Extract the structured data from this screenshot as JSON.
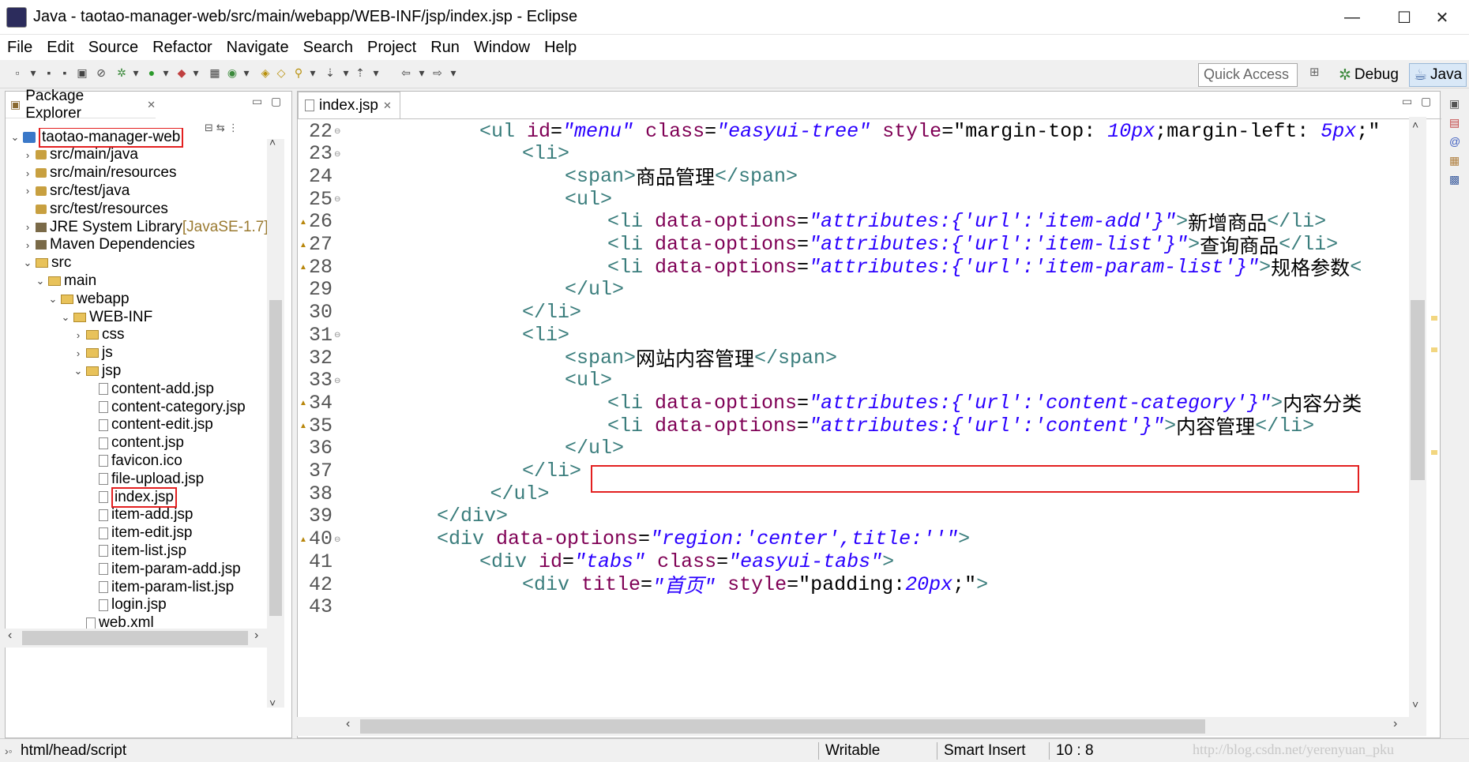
{
  "window": {
    "title": "Java - taotao-manager-web/src/main/webapp/WEB-INF/jsp/index.jsp - Eclipse",
    "minimize": "—",
    "maximize": "☐",
    "close": "✕"
  },
  "menu": [
    "File",
    "Edit",
    "Source",
    "Refactor",
    "Navigate",
    "Search",
    "Project",
    "Run",
    "Window",
    "Help"
  ],
  "toolbar": {
    "quick_access": "Quick Access",
    "perspectives": [
      "Debug",
      "Java"
    ]
  },
  "package_explorer": {
    "title": "Package Explorer",
    "items": [
      {
        "label": "taotao-manager-web",
        "depth": 0,
        "twisty": "⌄",
        "icon": "project-icon"
      },
      {
        "label": "src/main/java",
        "depth": 1,
        "twisty": "›",
        "icon": "source-folder-icon"
      },
      {
        "label": "src/main/resources",
        "depth": 1,
        "twisty": "›",
        "icon": "source-folder-icon"
      },
      {
        "label": "src/test/java",
        "depth": 1,
        "twisty": "›",
        "icon": "source-folder-icon"
      },
      {
        "label": "src/test/resources",
        "depth": 1,
        "twisty": "",
        "icon": "source-folder-icon"
      },
      {
        "label": "JRE System Library",
        "suffix": " [JavaSE-1.7]",
        "depth": 1,
        "twisty": "›",
        "icon": "library-icon"
      },
      {
        "label": "Maven Dependencies",
        "depth": 1,
        "twisty": "›",
        "icon": "library-icon"
      },
      {
        "label": "src",
        "depth": 1,
        "twisty": "⌄",
        "icon": "folder-icon"
      },
      {
        "label": "main",
        "depth": 2,
        "twisty": "⌄",
        "icon": "folder-icon"
      },
      {
        "label": "webapp",
        "depth": 3,
        "twisty": "⌄",
        "icon": "folder-icon"
      },
      {
        "label": "WEB-INF",
        "depth": 4,
        "twisty": "⌄",
        "icon": "folder-icon"
      },
      {
        "label": "css",
        "depth": 5,
        "twisty": "›",
        "icon": "folder-icon"
      },
      {
        "label": "js",
        "depth": 5,
        "twisty": "›",
        "icon": "folder-icon"
      },
      {
        "label": "jsp",
        "depth": 5,
        "twisty": "⌄",
        "icon": "folder-icon"
      },
      {
        "label": "content-add.jsp",
        "depth": 6,
        "twisty": "",
        "icon": "jsp-file-icon"
      },
      {
        "label": "content-category.jsp",
        "depth": 6,
        "twisty": "",
        "icon": "jsp-file-icon"
      },
      {
        "label": "content-edit.jsp",
        "depth": 6,
        "twisty": "",
        "icon": "jsp-file-icon"
      },
      {
        "label": "content.jsp",
        "depth": 6,
        "twisty": "",
        "icon": "jsp-file-icon"
      },
      {
        "label": "favicon.ico",
        "depth": 6,
        "twisty": "",
        "icon": "file-icon"
      },
      {
        "label": "file-upload.jsp",
        "depth": 6,
        "twisty": "",
        "icon": "jsp-file-icon"
      },
      {
        "label": "index.jsp",
        "depth": 6,
        "twisty": "",
        "icon": "jsp-file-icon"
      },
      {
        "label": "item-add.jsp",
        "depth": 6,
        "twisty": "",
        "icon": "jsp-file-icon"
      },
      {
        "label": "item-edit.jsp",
        "depth": 6,
        "twisty": "",
        "icon": "jsp-file-icon"
      },
      {
        "label": "item-list.jsp",
        "depth": 6,
        "twisty": "",
        "icon": "jsp-file-icon"
      },
      {
        "label": "item-param-add.jsp",
        "depth": 6,
        "twisty": "",
        "icon": "jsp-file-icon"
      },
      {
        "label": "item-param-list.jsp",
        "depth": 6,
        "twisty": "",
        "icon": "jsp-file-icon"
      },
      {
        "label": "login.jsp",
        "depth": 6,
        "twisty": "",
        "icon": "jsp-file-icon"
      },
      {
        "label": "web.xml",
        "depth": 5,
        "twisty": "",
        "icon": "file-icon"
      }
    ]
  },
  "editor": {
    "tab": "index.jsp",
    "lines": [
      {
        "n": "22",
        "fold": true,
        "warn": false,
        "indent": 3,
        "t": [
          [
            "tg",
            "<ul "
          ],
          [
            "at",
            "id"
          ],
          [
            "tx",
            "="
          ],
          [
            "st",
            "\"menu\""
          ],
          [
            "tx",
            " "
          ],
          [
            "at",
            "class"
          ],
          [
            "tx",
            "="
          ],
          [
            "st",
            "\"easyui-tree\""
          ],
          [
            "tx",
            " "
          ],
          [
            "at",
            "style"
          ],
          [
            "tx",
            "=\"margin-top: "
          ],
          [
            "st",
            "10px"
          ],
          [
            "tx",
            ";margin-left: "
          ],
          [
            "st",
            "5px"
          ],
          [
            "tx",
            ";\""
          ]
        ]
      },
      {
        "n": "23",
        "fold": true,
        "warn": false,
        "indent": 4,
        "t": [
          [
            "tg",
            "<li>"
          ]
        ]
      },
      {
        "n": "24",
        "fold": false,
        "warn": false,
        "indent": 5,
        "t": [
          [
            "tg",
            "<span>"
          ],
          [
            "tx",
            "商品管理"
          ],
          [
            "tg",
            "</span>"
          ]
        ]
      },
      {
        "n": "25",
        "fold": true,
        "warn": false,
        "indent": 5,
        "t": [
          [
            "tg",
            "<ul>"
          ]
        ]
      },
      {
        "n": "26",
        "fold": false,
        "warn": true,
        "indent": 6,
        "t": [
          [
            "tg",
            "<li "
          ],
          [
            "at",
            "data-options"
          ],
          [
            "tx",
            "="
          ],
          [
            "st",
            "\"attributes:{'url':'item-add'}\""
          ],
          [
            "tg",
            ">"
          ],
          [
            "tx",
            "新增商品"
          ],
          [
            "tg",
            "</li>"
          ]
        ]
      },
      {
        "n": "27",
        "fold": false,
        "warn": true,
        "indent": 6,
        "t": [
          [
            "tg",
            "<li "
          ],
          [
            "at",
            "data-options"
          ],
          [
            "tx",
            "="
          ],
          [
            "st",
            "\"attributes:{'url':'item-list'}\""
          ],
          [
            "tg",
            ">"
          ],
          [
            "tx",
            "查询商品"
          ],
          [
            "tg",
            "</li>"
          ]
        ]
      },
      {
        "n": "28",
        "fold": false,
        "warn": true,
        "indent": 6,
        "t": [
          [
            "tg",
            "<li "
          ],
          [
            "at",
            "data-options"
          ],
          [
            "tx",
            "="
          ],
          [
            "st",
            "\"attributes:{'url':'item-param-list'}\""
          ],
          [
            "tg",
            ">"
          ],
          [
            "tx",
            "规格参数"
          ],
          [
            "tg",
            "<"
          ]
        ]
      },
      {
        "n": "29",
        "fold": false,
        "warn": false,
        "indent": 5,
        "t": [
          [
            "tg",
            "</ul>"
          ]
        ]
      },
      {
        "n": "30",
        "fold": false,
        "warn": false,
        "indent": 4,
        "t": [
          [
            "tg",
            "</li>"
          ]
        ]
      },
      {
        "n": "31",
        "fold": true,
        "warn": false,
        "indent": 4,
        "t": [
          [
            "tg",
            "<li>"
          ]
        ]
      },
      {
        "n": "32",
        "fold": false,
        "warn": false,
        "indent": 5,
        "t": [
          [
            "tg",
            "<span>"
          ],
          [
            "tx",
            "网站内容管理"
          ],
          [
            "tg",
            "</span>"
          ]
        ]
      },
      {
        "n": "33",
        "fold": true,
        "warn": false,
        "indent": 5,
        "t": [
          [
            "tg",
            "<ul>"
          ]
        ]
      },
      {
        "n": "34",
        "fold": false,
        "warn": true,
        "indent": 6,
        "t": [
          [
            "tg",
            "<li "
          ],
          [
            "at",
            "data-options"
          ],
          [
            "tx",
            "="
          ],
          [
            "st",
            "\"attributes:{'url':'content-category'}\""
          ],
          [
            "tg",
            ">"
          ],
          [
            "tx",
            "内容分类"
          ]
        ]
      },
      {
        "n": "35",
        "fold": false,
        "warn": true,
        "indent": 6,
        "t": [
          [
            "tg",
            "<li "
          ],
          [
            "at",
            "data-options"
          ],
          [
            "tx",
            "="
          ],
          [
            "st",
            "\"attributes:{'url':'content'}\""
          ],
          [
            "tg",
            ">"
          ],
          [
            "tx",
            "内容管理"
          ],
          [
            "tg",
            "</li>"
          ]
        ]
      },
      {
        "n": "36",
        "fold": false,
        "warn": false,
        "indent": 5,
        "t": [
          [
            "tg",
            "</ul>"
          ]
        ]
      },
      {
        "n": "37",
        "fold": false,
        "warn": false,
        "indent": 4,
        "t": [
          [
            "tg",
            "</li>"
          ]
        ]
      },
      {
        "n": "38",
        "fold": false,
        "warn": false,
        "indent": 3.25,
        "t": [
          [
            "tg",
            "</ul>"
          ]
        ]
      },
      {
        "n": "39",
        "fold": false,
        "warn": false,
        "indent": 2,
        "t": [
          [
            "tg",
            "</div>"
          ]
        ]
      },
      {
        "n": "40",
        "fold": true,
        "warn": true,
        "indent": 2,
        "t": [
          [
            "tg",
            "<div "
          ],
          [
            "at",
            "data-options"
          ],
          [
            "tx",
            "="
          ],
          [
            "st",
            "\"region:'center',title:''\""
          ],
          [
            "tg",
            ">"
          ]
        ]
      },
      {
        "n": "41",
        "fold": false,
        "warn": false,
        "indent": 3,
        "t": [
          [
            "tg",
            "<div "
          ],
          [
            "at",
            "id"
          ],
          [
            "tx",
            "="
          ],
          [
            "st",
            "\"tabs\""
          ],
          [
            "tx",
            " "
          ],
          [
            "at",
            "class"
          ],
          [
            "tx",
            "="
          ],
          [
            "st",
            "\"easyui-tabs\""
          ],
          [
            "tg",
            ">"
          ]
        ]
      },
      {
        "n": "42",
        "fold": false,
        "warn": false,
        "indent": 4,
        "t": [
          [
            "tg",
            "<div "
          ],
          [
            "at",
            "title"
          ],
          [
            "tx",
            "="
          ],
          [
            "st",
            "\"首页\""
          ],
          [
            "tx",
            " "
          ],
          [
            "at",
            "style"
          ],
          [
            "tx",
            "=\"padding:"
          ],
          [
            "st",
            "20px"
          ],
          [
            "tx",
            ";\""
          ],
          [
            "tg",
            ">"
          ]
        ]
      },
      {
        "n": "43",
        "fold": false,
        "warn": false,
        "indent": 0,
        "t": []
      }
    ]
  },
  "status": {
    "path": "html/head/script",
    "writable": "Writable",
    "insert_mode": "Smart Insert",
    "position": "10 : 8"
  },
  "watermark": "http://blog.csdn.net/yerenyuan_pku",
  "colors": {
    "tag": "#3a7d7c",
    "attr": "#7f0055",
    "string": "#2a00ff",
    "highlight": "#e32020"
  }
}
